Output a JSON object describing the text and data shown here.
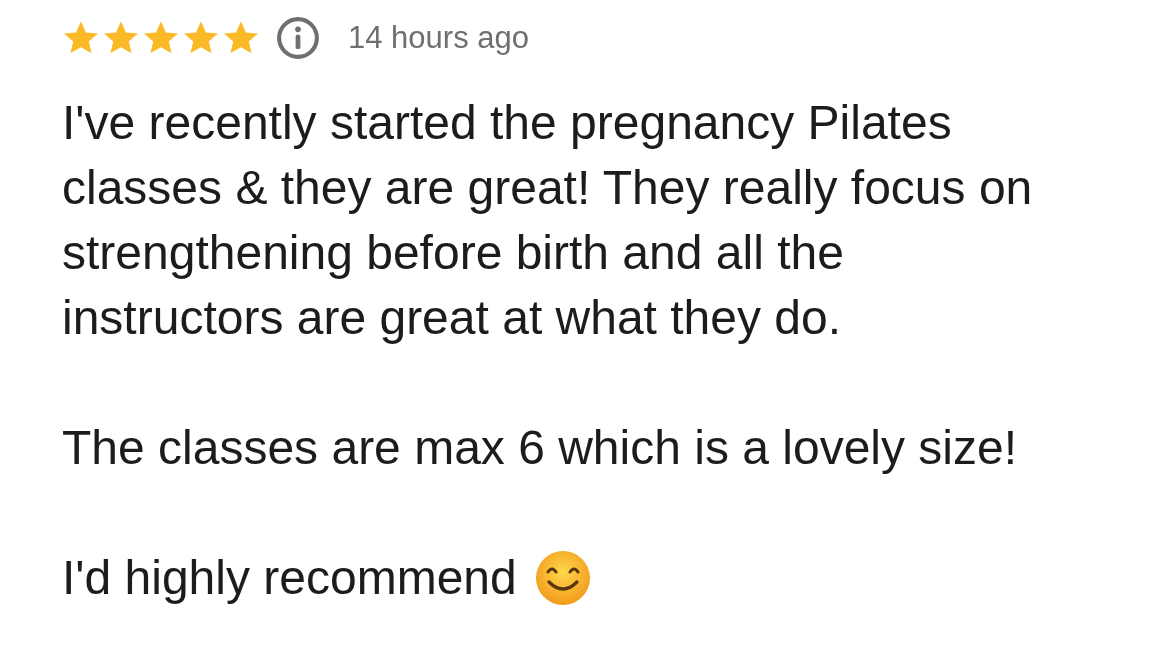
{
  "review": {
    "stars": 5,
    "time": "14 hours ago",
    "paragraphs": [
      "I've recently started the pregnancy Pilates classes & they are great! They really focus on strengthening before birth and all the instructors are great at what they do.",
      "The classes are max 6 which is a lovely size!",
      "I'd highly recommend"
    ]
  }
}
